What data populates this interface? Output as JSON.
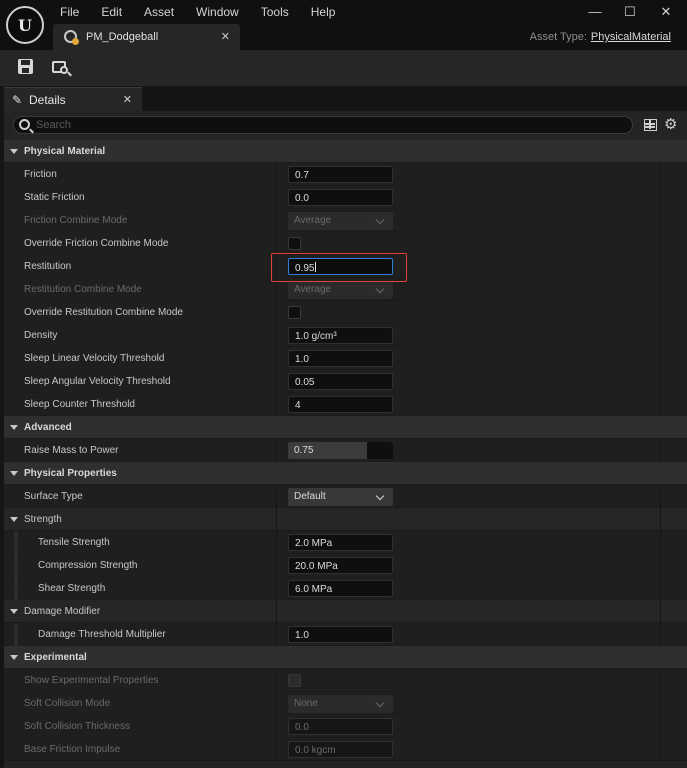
{
  "app": {
    "logo": "U",
    "menu": [
      "File",
      "Edit",
      "Asset",
      "Window",
      "Tools",
      "Help"
    ],
    "window_controls": [
      "minimize-icon",
      "maximize-icon",
      "close-icon"
    ],
    "document_tab": "PM_Dodgeball",
    "asset_type_label": "Asset Type:",
    "asset_type_value": "PhysicalMaterial"
  },
  "toolbar": {
    "icons": [
      "save-icon",
      "browse-icon"
    ]
  },
  "panel": {
    "tab_label": "Details",
    "search_placeholder": "Search"
  },
  "rows": [
    {
      "kind": "cat",
      "label": "Physical Material"
    },
    {
      "kind": "prop",
      "label": "Friction",
      "control": "field",
      "value": "0.7"
    },
    {
      "kind": "prop",
      "label": "Static Friction",
      "control": "field",
      "value": "0.0"
    },
    {
      "kind": "prop",
      "label": "Friction Combine Mode",
      "control": "combo",
      "value": "Average",
      "disabled": true
    },
    {
      "kind": "prop",
      "label": "Override Friction Combine Mode",
      "control": "check"
    },
    {
      "kind": "prop",
      "label": "Restitution",
      "control": "field",
      "value": "0.95",
      "focus": true
    },
    {
      "kind": "prop",
      "label": "Restitution Combine Mode",
      "control": "combo",
      "value": "Average",
      "disabled": true
    },
    {
      "kind": "prop",
      "label": "Override Restitution Combine Mode",
      "control": "check"
    },
    {
      "kind": "prop",
      "label": "Density",
      "control": "field",
      "value": "1.0 g/cm³"
    },
    {
      "kind": "prop",
      "label": "Sleep Linear Velocity Threshold",
      "control": "field",
      "value": "1.0"
    },
    {
      "kind": "prop",
      "label": "Sleep Angular Velocity Threshold",
      "control": "field",
      "value": "0.05"
    },
    {
      "kind": "prop",
      "label": "Sleep Counter Threshold",
      "control": "field",
      "value": "4"
    },
    {
      "kind": "cat",
      "label": "Advanced"
    },
    {
      "kind": "prop",
      "label": "Raise Mass to Power",
      "control": "slider",
      "value": "0.75",
      "fill": 0.75
    },
    {
      "kind": "cat",
      "label": "Physical Properties"
    },
    {
      "kind": "prop",
      "label": "Surface Type",
      "control": "combo",
      "value": "Default"
    },
    {
      "kind": "sub",
      "label": "Strength"
    },
    {
      "kind": "prop",
      "label": "Tensile Strength",
      "control": "field",
      "value": "2.0 MPa",
      "nested": true
    },
    {
      "kind": "prop",
      "label": "Compression Strength",
      "control": "field",
      "value": "20.0 MPa",
      "nested": true
    },
    {
      "kind": "prop",
      "label": "Shear Strength",
      "control": "field",
      "value": "6.0 MPa",
      "nested": true
    },
    {
      "kind": "sub",
      "label": "Damage Modifier"
    },
    {
      "kind": "prop",
      "label": "Damage Threshold Multiplier",
      "control": "field",
      "value": "1.0",
      "nested": true
    },
    {
      "kind": "cat",
      "label": "Experimental"
    },
    {
      "kind": "prop",
      "label": "Show Experimental Properties",
      "control": "check",
      "disabled": true
    },
    {
      "kind": "prop",
      "label": "Soft Collision Mode",
      "control": "combo",
      "value": "None",
      "disabled": true
    },
    {
      "kind": "prop",
      "label": "Soft Collision Thickness",
      "control": "field",
      "value": "0.0",
      "disabled": true
    },
    {
      "kind": "prop",
      "label": "Base Friction Impulse",
      "control": "field",
      "value": "0.0 kgcm",
      "disabled": true
    }
  ],
  "colors": {
    "focus_border": "#2b7fd9",
    "highlight_box": "#e0413a",
    "asset_accent": "#e0a93a"
  }
}
